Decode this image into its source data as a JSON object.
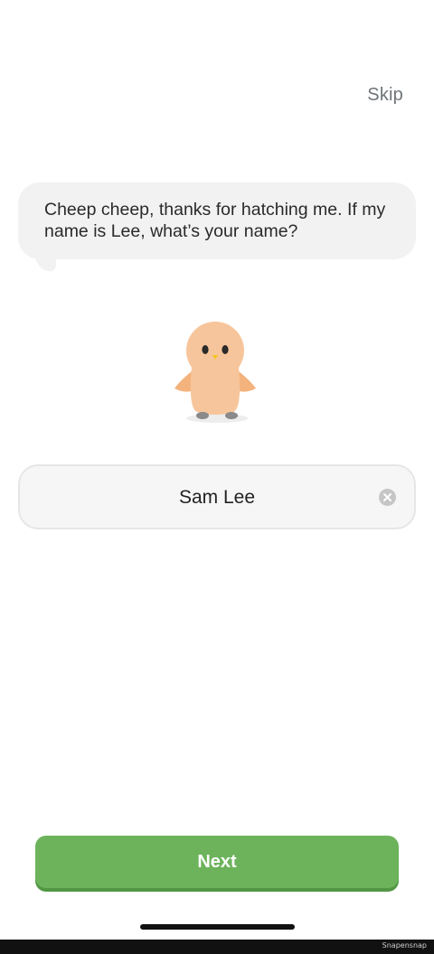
{
  "header": {
    "skip_label": "Skip"
  },
  "dialog": {
    "message": "Cheep cheep, thanks for hatching me. If my name is Lee, what’s your name?"
  },
  "name_field": {
    "value": "Sam Lee",
    "clear_icon": "clear-x-circle-icon"
  },
  "footer": {
    "next_label": "Next"
  },
  "watermark": {
    "text": "Snapensnap"
  },
  "colors": {
    "primary_button": "#6db35c",
    "primary_button_shadow": "#529743",
    "bubble_bg": "#f2f2f2",
    "chick_body": "#f7c59b",
    "chick_wing": "#f4b27c",
    "beak": "#f2c518"
  }
}
